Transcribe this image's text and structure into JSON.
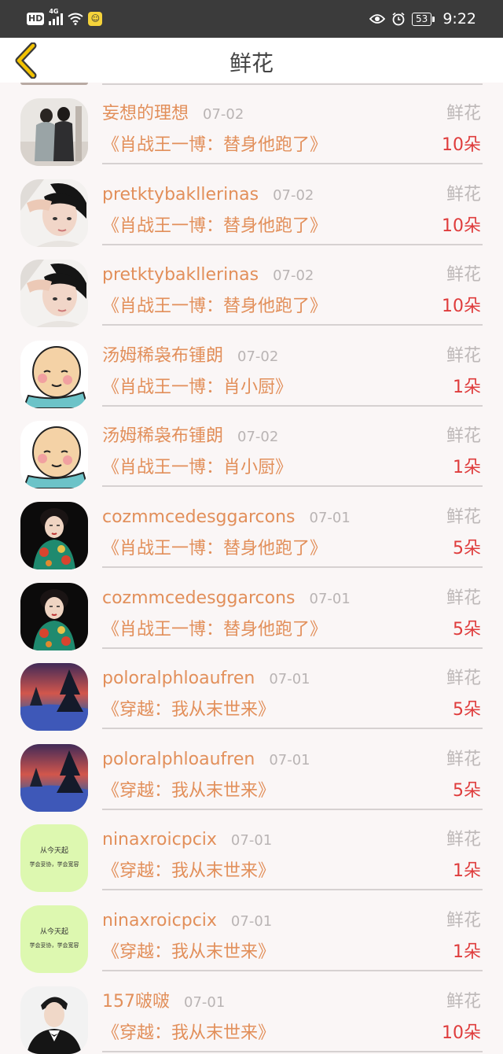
{
  "status_bar": {
    "hd": "HD",
    "network": "4G",
    "app_icon": "smiley-app-icon",
    "battery": "53",
    "time": "9:22"
  },
  "header": {
    "title": "鲜花",
    "back_icon": "chevron-left-icon",
    "accent_color": "#f2c200"
  },
  "colors": {
    "username": "#e28f5a",
    "amount": "#df3c3c",
    "label": "#bdb8b8"
  },
  "items": [
    {
      "user": "妄想的理想",
      "date": "07-02",
      "type": "鲜花",
      "book": "《肖战王一博：替身他跑了》",
      "amount": "10朵",
      "avatar": "couple-photo-avatar"
    },
    {
      "user": "pretktybakllerinas",
      "date": "07-02",
      "type": "鲜花",
      "book": "《肖战王一博：替身他跑了》",
      "amount": "10朵",
      "avatar": "portrait-avatar"
    },
    {
      "user": "pretktybakllerinas",
      "date": "07-02",
      "type": "鲜花",
      "book": "《肖战王一博：替身他跑了》",
      "amount": "10朵",
      "avatar": "portrait-avatar"
    },
    {
      "user": "汤姆稀袅布锺朗",
      "date": "07-02",
      "type": "鲜花",
      "book": "《肖战王一博：肖小厨》",
      "amount": "1朵",
      "avatar": "cartoon-bald-man-avatar"
    },
    {
      "user": "汤姆稀袅布锺朗",
      "date": "07-02",
      "type": "鲜花",
      "book": "《肖战王一博：肖小厨》",
      "amount": "1朵",
      "avatar": "cartoon-bald-man-avatar"
    },
    {
      "user": "cozmmcedesggarcons",
      "date": "07-01",
      "type": "鲜花",
      "book": "《肖战王一博：替身他跑了》",
      "amount": "5朵",
      "avatar": "qipao-lady-avatar"
    },
    {
      "user": "cozmmcedesggarcons",
      "date": "07-01",
      "type": "鲜花",
      "book": "《肖战王一博：替身他跑了》",
      "amount": "5朵",
      "avatar": "qipao-lady-avatar"
    },
    {
      "user": "poloralphloaufren",
      "date": "07-01",
      "type": "鲜花",
      "book": "《穿越：我从末世来》",
      "amount": "5朵",
      "avatar": "winter-landscape-avatar"
    },
    {
      "user": "poloralphloaufren",
      "date": "07-01",
      "type": "鲜花",
      "book": "《穿越：我从末世来》",
      "amount": "5朵",
      "avatar": "winter-landscape-avatar"
    },
    {
      "user": "ninaxroicpcix",
      "date": "07-01",
      "type": "鲜花",
      "book": "《穿越：我从末世来》",
      "amount": "1朵",
      "avatar": "text-card-avatar",
      "avatar_line1": "从今天起",
      "avatar_line2": "学会妥协，学会宽容"
    },
    {
      "user": "ninaxroicpcix",
      "date": "07-01",
      "type": "鲜花",
      "book": "《穿越：我从末世来》",
      "amount": "1朵",
      "avatar": "text-card-avatar",
      "avatar_line1": "从今天起",
      "avatar_line2": "学会妥协，学会宽容"
    },
    {
      "user": "157啵啵",
      "date": "07-01",
      "type": "鲜花",
      "book": "《穿越：我从末世来》",
      "amount": "10朵",
      "avatar": "man-in-suit-avatar"
    }
  ]
}
